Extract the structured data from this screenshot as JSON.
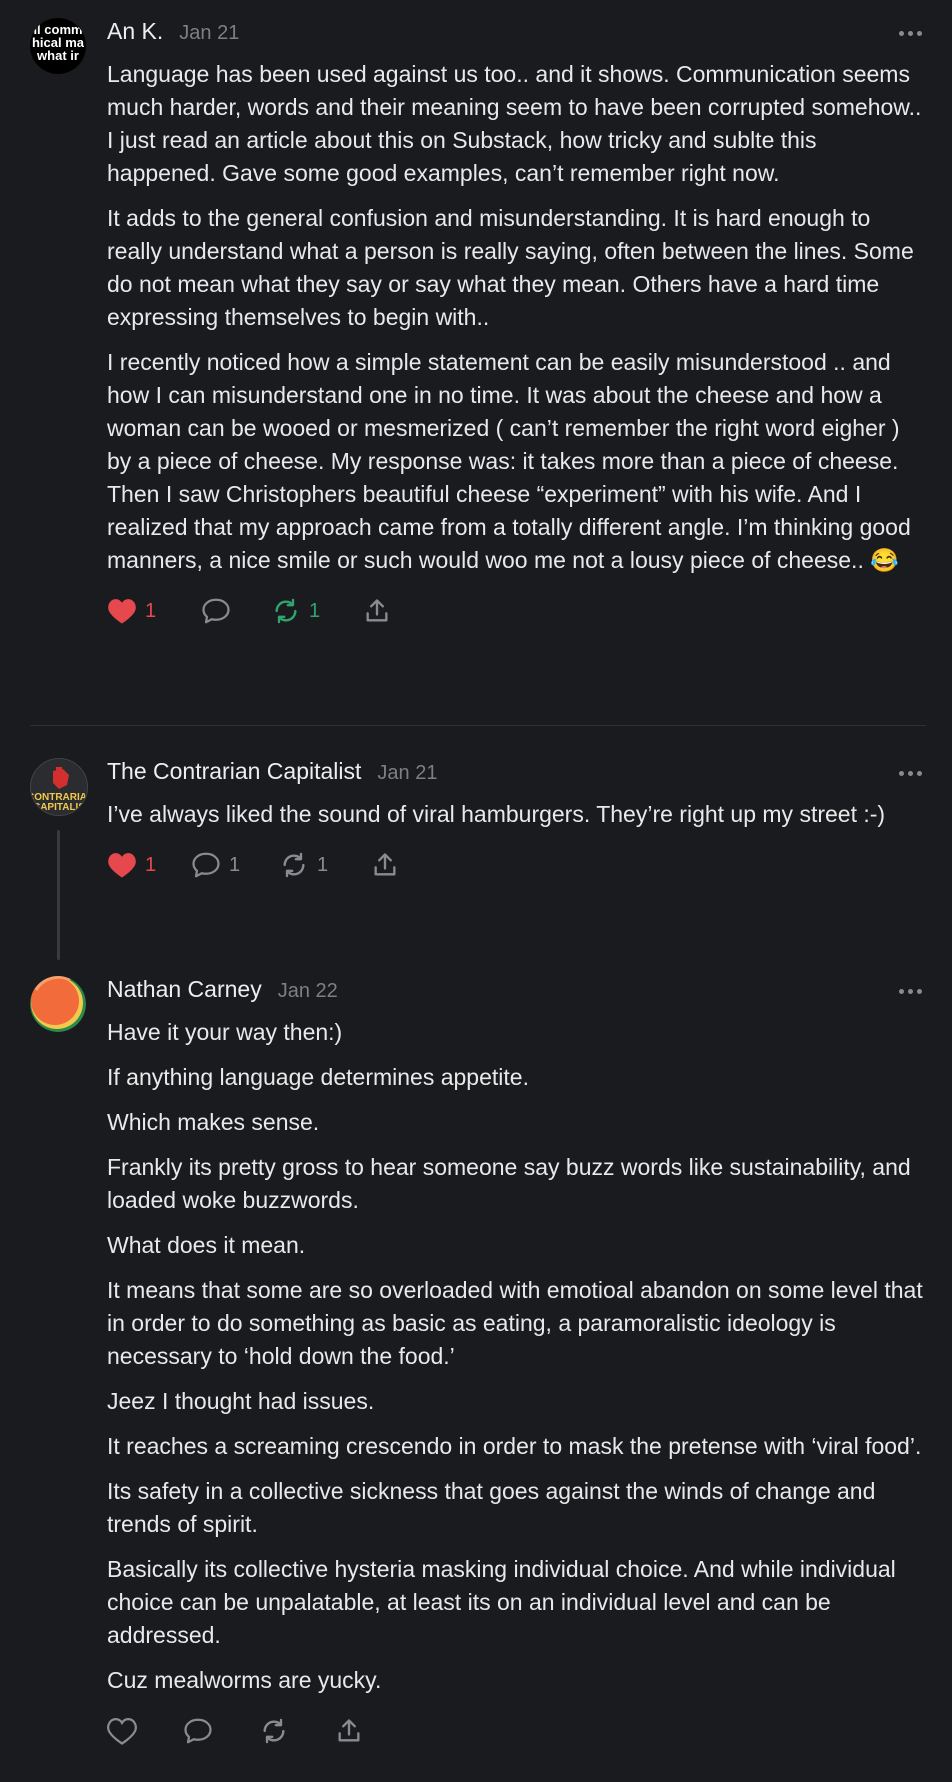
{
  "comments": [
    {
      "author": "An K.",
      "date": "Jan 21",
      "avatar_text": [
        "ll comm",
        "hical ma",
        "what ir"
      ],
      "paragraphs": [
        "Language has been used against us too.. and it shows. Communication seems much harder, words and their meaning seem to have been corrupted somehow.. I just read an article about this on Substack, how tricky and sublte this happened. Gave some good examples, can’t remember right now.",
        "It adds to the general confusion and misunderstanding. It is hard enough to really understand what a person is really saying, often between the lines. Some do not mean what they say or say what they mean. Others have a hard time expressing themselves to begin with..",
        "I recently noticed how a simple statement can be easily misunderstood .. and how I can misunderstand one in no time. It was about the cheese and how a woman can be wooed or mesmerized ( can’t remember the right word eigher ) by a piece of cheese. My response was: it takes more than a piece of cheese. Then I saw Christophers beautiful cheese “experiment” with his wife. And I realized that my approach came from a totally different angle. I’m thinking good manners, a nice smile or such would woo me not a lousy piece of cheese.. 😂"
      ],
      "likes": "1",
      "replies": "",
      "restacks": "1",
      "liked": true,
      "restacked": true
    },
    {
      "author": "The Contrarian Capitalist",
      "date": "Jan 21",
      "avatar_text": [
        "CONTRARIAN",
        "CAPITALIS"
      ],
      "paragraphs": [
        "I’ve always liked the sound of viral hamburgers. They’re right up my street :-)"
      ],
      "likes": "1",
      "replies": "1",
      "restacks": "1",
      "liked": true,
      "restacked": false
    },
    {
      "author": "Nathan Carney",
      "date": "Jan 22",
      "paragraphs": [
        "Have it your way then:)",
        "If anything language determines appetite.",
        "Which makes sense.",
        "Frankly its pretty gross to hear someone say buzz words like sustainability, and loaded woke buzzwords.",
        "What does it mean.",
        "It means that some are so overloaded with emotioal abandon on some level that in order to do something as basic as eating, a paramoralistic ideology is necessary to ‘hold down the food.’",
        "Jeez I thought had issues.",
        "It reaches a screaming crescendo in order to mask the pretense with ‘viral food’.",
        "Its safety in a collective sickness that goes against the winds of change and trends of spirit.",
        "Basically its collective hysteria masking individual choice. And while individual choice can be unpalatable, at least its on an individual level and can be addressed.",
        "Cuz mealworms are yucky."
      ],
      "likes": "",
      "replies": "",
      "restacks": "",
      "liked": false,
      "restacked": false
    }
  ],
  "colors": {
    "background": "#1a1b1e",
    "like_active": "#e5484d",
    "restack_active": "#30a46c",
    "muted": "#8a8b90"
  },
  "icons": [
    "heart-icon",
    "comment-icon",
    "restack-icon",
    "share-icon",
    "more-dots-icon"
  ]
}
